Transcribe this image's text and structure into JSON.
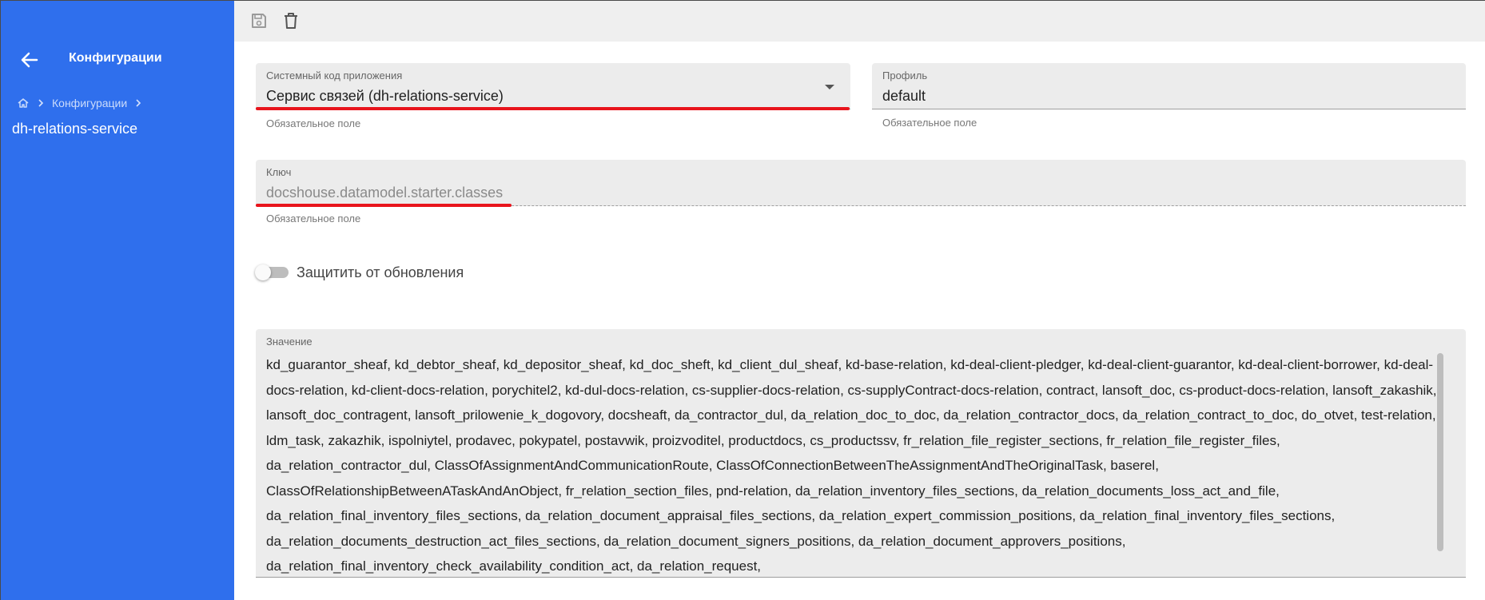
{
  "sidebar": {
    "title": "Конфигурации",
    "breadcrumb": {
      "home_icon": "home-icon",
      "separator_icon": "chevron-right-icon",
      "link_label": "Конфигурации"
    },
    "current_item": "dh-relations-service",
    "back_icon": "arrow-left-icon",
    "background_color": "#2f6fed"
  },
  "toolbar": {
    "save_icon": "save-icon",
    "delete_icon": "trash-icon"
  },
  "form": {
    "app_code": {
      "label": "Системный код приложения",
      "value": "Сервис связей (dh-relations-service)",
      "hint": "Обязательное поле"
    },
    "profile": {
      "label": "Профиль",
      "value": "default",
      "hint": "Обязательное поле"
    },
    "key": {
      "label": "Ключ",
      "value": "docshouse.datamodel.starter.classes",
      "hint": "Обязательное поле"
    },
    "protect_toggle": {
      "label": "Защитить от обновления",
      "checked": false
    },
    "value_field": {
      "label": "Значение",
      "text": "kd_guarantor_sheaf, kd_debtor_sheaf, kd_depositor_sheaf, kd_doc_sheft, kd_client_dul_sheaf, kd-base-relation, kd-deal-client-pledger, kd-deal-client-guarantor, kd-deal-client-borrower, kd-deal-docs-relation, kd-client-docs-relation, porychitel2, kd-dul-docs-relation, cs-supplier-docs-relation, cs-supplyContract-docs-relation, contract, lansoft_doc, cs-product-docs-relation, lansoft_zakashik, lansoft_doc_contragent, lansoft_prilowenie_k_dogovory, docsheaft, da_contractor_dul, da_relation_doc_to_doc, da_relation_contractor_docs, da_relation_contract_to_doc, do_otvet, test-relation, ldm_task, zakazhik, ispolniytel, prodavec, pokypatel, postavwik, proizvoditel, productdocs, cs_productssv, fr_relation_file_register_sections, fr_relation_file_register_files, da_relation_contractor_dul, ClassOfAssignmentAndCommunicationRoute, ClassOfConnectionBetweenTheAssignmentAndTheOriginalTask, baserel, ClassOfRelationshipBetweenATaskAndAnObject, fr_relation_section_files, pnd-relation, da_relation_inventory_files_sections, da_relation_documents_loss_act_and_file, da_relation_final_inventory_files_sections, da_relation_document_appraisal_files_sections, da_relation_expert_commission_positions, da_relation_final_inventory_files_sections, da_relation_documents_destruction_act_files_sections, da_relation_document_signers_positions, da_relation_document_approvers_positions, da_relation_final_inventory_check_availability_condition_act, da_relation_request,"
    }
  },
  "colors": {
    "accent": "#2f6fed",
    "annotation_red": "#e8141c"
  }
}
